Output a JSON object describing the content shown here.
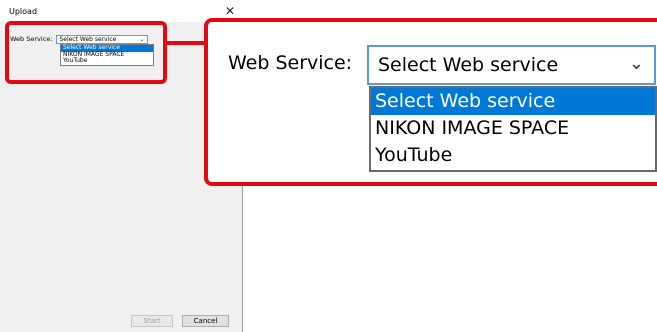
{
  "window": {
    "title": "Upload"
  },
  "web_service": {
    "label": "Web Service:",
    "small_label": "Web Service:",
    "selected": "Select Web service",
    "options": [
      "Select Web service",
      "NIKON IMAGE SPACE",
      "YouTube"
    ]
  },
  "buttons": {
    "start": "Start",
    "cancel": "Cancel"
  },
  "colors": {
    "callout": "#e30613",
    "selection": "#0078d7",
    "dialog_bg": "#f0f0f0",
    "select_border": "#5b9bd5"
  },
  "icons": {
    "close": "close-icon",
    "dropdown": "chevron-down-icon"
  }
}
